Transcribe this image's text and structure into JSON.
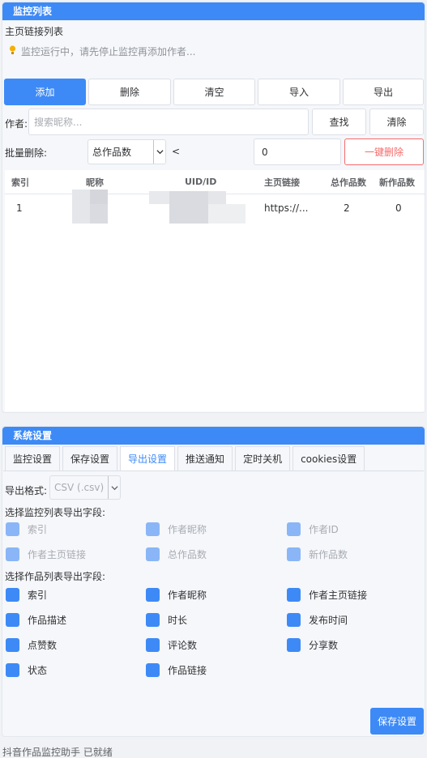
{
  "monitor": {
    "title": "监控列表",
    "subtitle": "主页链接列表",
    "hint": "监控运行中，请先停止监控再添加作者...",
    "buttons": {
      "add": "添加",
      "delete": "删除",
      "clear": "清空",
      "import": "导入",
      "export": "导出"
    },
    "author_label": "作者:",
    "search_placeholder": "搜索昵称...",
    "find": "查找",
    "clear_search": "清除",
    "batch_label": "批量删除:",
    "batch_field": "总作品数",
    "batch_op": "<",
    "batch_value": "0",
    "one_click_delete": "一键删除",
    "columns": [
      "索引",
      "昵称",
      "UID/ID",
      "主页链接",
      "总作品数",
      "新作品数"
    ],
    "rows": [
      {
        "index": "1",
        "link": "https://...",
        "total": "2",
        "new": "0"
      }
    ]
  },
  "settings": {
    "title": "系统设置",
    "tabs": [
      "监控设置",
      "保存设置",
      "导出设置",
      "推送通知",
      "定时关机",
      "cookies设置"
    ],
    "active_tab": "导出设置",
    "format_label": "导出格式:",
    "format_value": "CSV (.csv)",
    "monitor_fields_label": "选择监控列表导出字段:",
    "monitor_fields": [
      "索引",
      "作者昵称",
      "作者ID",
      "作者主页链接",
      "总作品数",
      "新作品数"
    ],
    "work_fields_label": "选择作品列表导出字段:",
    "work_fields": [
      "索引",
      "作者昵称",
      "作者主页链接",
      "作品描述",
      "时长",
      "发布时间",
      "点赞数",
      "评论数",
      "分享数",
      "状态",
      "作品链接"
    ],
    "save_button": "保存设置"
  },
  "status_bar": "抖音作品监控助手 已就绪",
  "colors": {
    "accent": "#3d8af7",
    "danger": "#f56c6c"
  }
}
